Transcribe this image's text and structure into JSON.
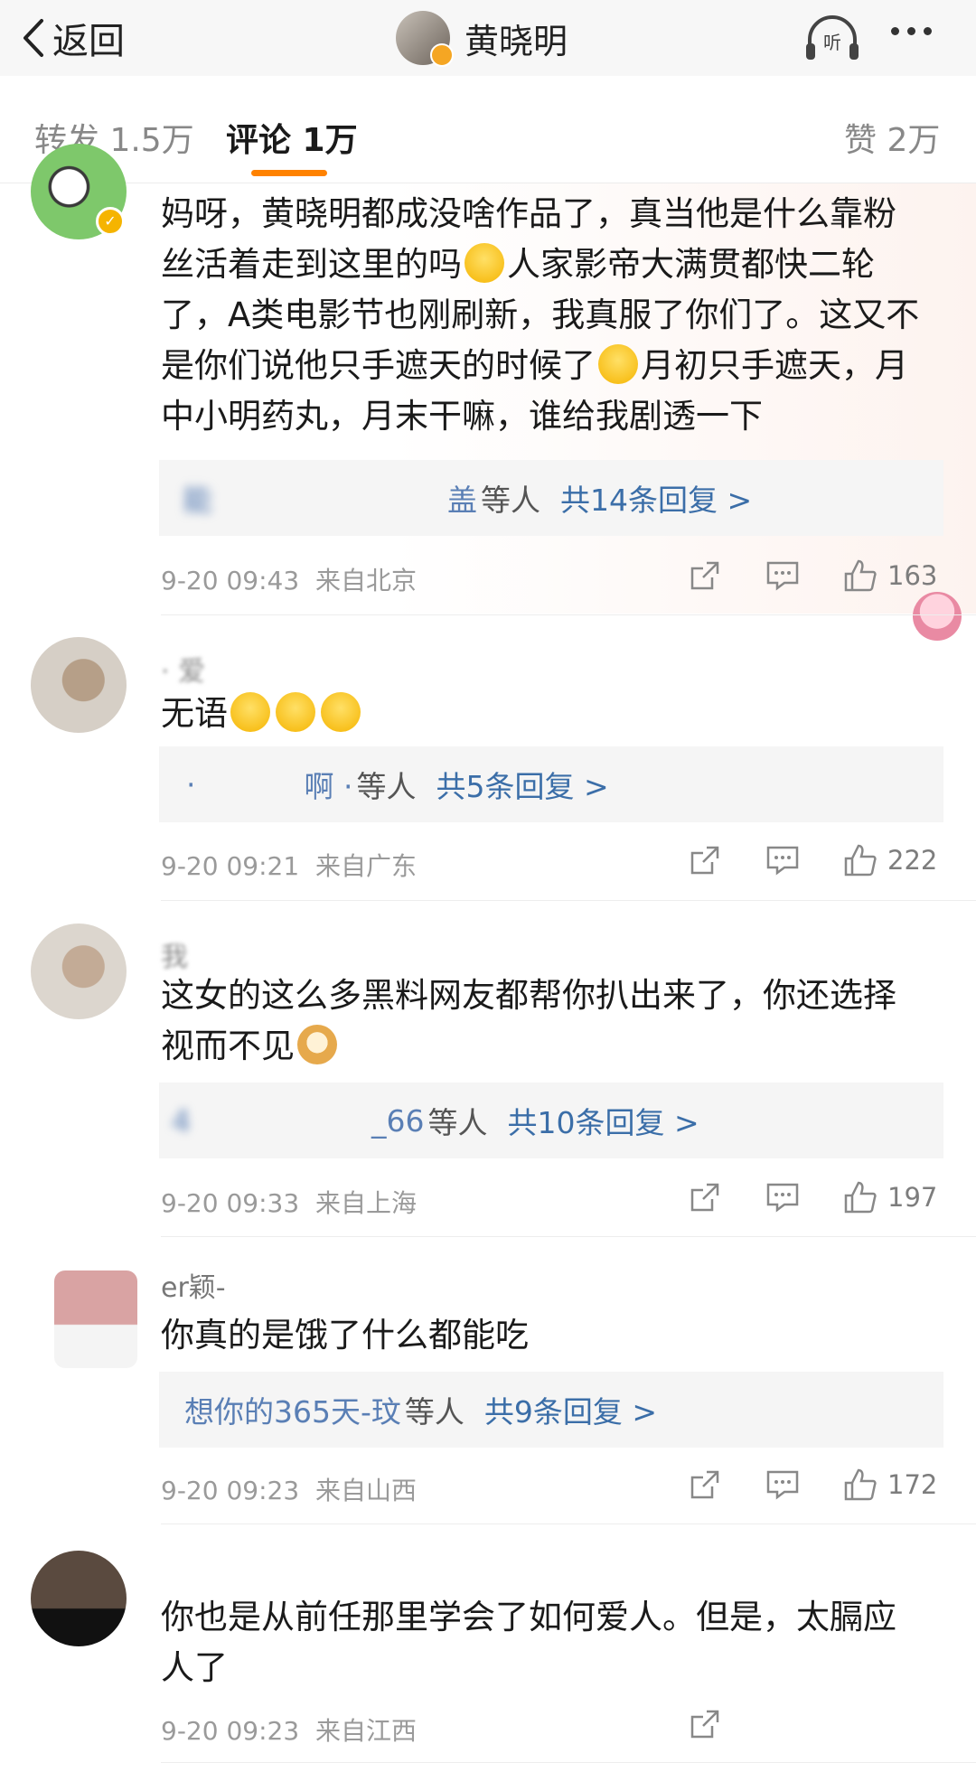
{
  "header": {
    "back_label": "返回",
    "profile_name": "黄晓明",
    "listen_label": "听"
  },
  "tabs": [
    {
      "label": "转发 1.5万"
    },
    {
      "label": "评论 1万"
    },
    {
      "label": "赞 2万"
    }
  ],
  "accent_color": "#ff8200",
  "comments": [
    {
      "text_before": "妈呀，黄晓明都成没啥作品了，真当他是什么靠粉丝活着走到这里的吗",
      "text_middle": "人家影帝大满贯都快二轮了，A类电影节也刚刷新，我真服了你们了。这又不是你们说他只手遮天的时候了",
      "text_after": "月初只手遮天，月中小明药丸，月末干嘛，谁给我剧透一下",
      "reply_prefix": "能",
      "reply_who": "盖",
      "reply_etc": "等人",
      "reply_count": "共14条回复 >",
      "time": "9-20 09:43",
      "location": "来自北京",
      "likes": "163"
    },
    {
      "username": "· 爱",
      "text": "无语",
      "reply_prefix": "·",
      "reply_who": "啊 ·",
      "reply_etc": "等人",
      "reply_count": "共5条回复 >",
      "time": "9-20 09:21",
      "location": "来自广东",
      "likes": "222"
    },
    {
      "username": "我",
      "text": "这女的这么多黑料网友都帮你扒出来了，你还选择视而不见",
      "reply_prefix": "4",
      "reply_who": "_66",
      "reply_etc": "等人",
      "reply_count": "共10条回复 >",
      "time": "9-20 09:33",
      "location": "来自上海",
      "likes": "197"
    },
    {
      "username": "er颖-",
      "text": "你真的是饿了什么都能吃",
      "reply_who": "想你的365天-玟",
      "reply_etc": "等人",
      "reply_count": "共9条回复 >",
      "time": "9-20 09:23",
      "location": "来自山西",
      "likes": "172"
    },
    {
      "username": "",
      "text": "你也是从前任那里学会了如何爱人。但是，太膈应人了",
      "time": "9-20 09:23",
      "location": "来自江西"
    }
  ],
  "icons": [
    "chevron-left-icon",
    "headphones-icon",
    "more-icon",
    "verified-icon",
    "share-icon",
    "comment-icon",
    "like-icon"
  ]
}
